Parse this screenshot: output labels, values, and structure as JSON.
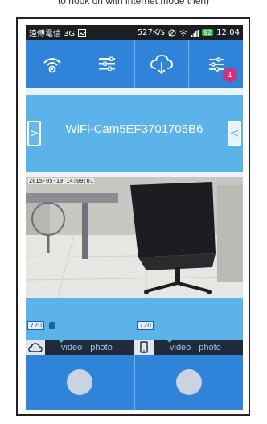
{
  "caption": "to hook on with internet mode then)",
  "status_bar": {
    "carrier": "遠傳電信 3G",
    "speed": "527K/s",
    "battery": "92",
    "time": "12:04"
  },
  "toolbar": {
    "items": [
      {
        "name": "wifi",
        "icon": "wifi-icon"
      },
      {
        "name": "list",
        "icon": "list-icon"
      },
      {
        "name": "cloud-download",
        "icon": "cloud-download-icon"
      },
      {
        "name": "settings",
        "icon": "sliders-icon",
        "badge": "1"
      }
    ]
  },
  "camera": {
    "name": "WiFi-Cam5EF3701705B6",
    "prev_arrow": ">",
    "next_arrow": "<"
  },
  "preview": {
    "timestamp": "2015-05-19 14:09:01"
  },
  "cloud_panel": {
    "resolution": "720",
    "mode_video": "video",
    "mode_photo": "photo"
  },
  "phone_panel": {
    "resolution": "720",
    "mode_video": "video",
    "mode_photo": "photo"
  },
  "colors": {
    "toolbar": "#2f83d9",
    "accent": "#5bb3ea",
    "badge": "#d2317b",
    "modebar": "#1f2a3a"
  }
}
